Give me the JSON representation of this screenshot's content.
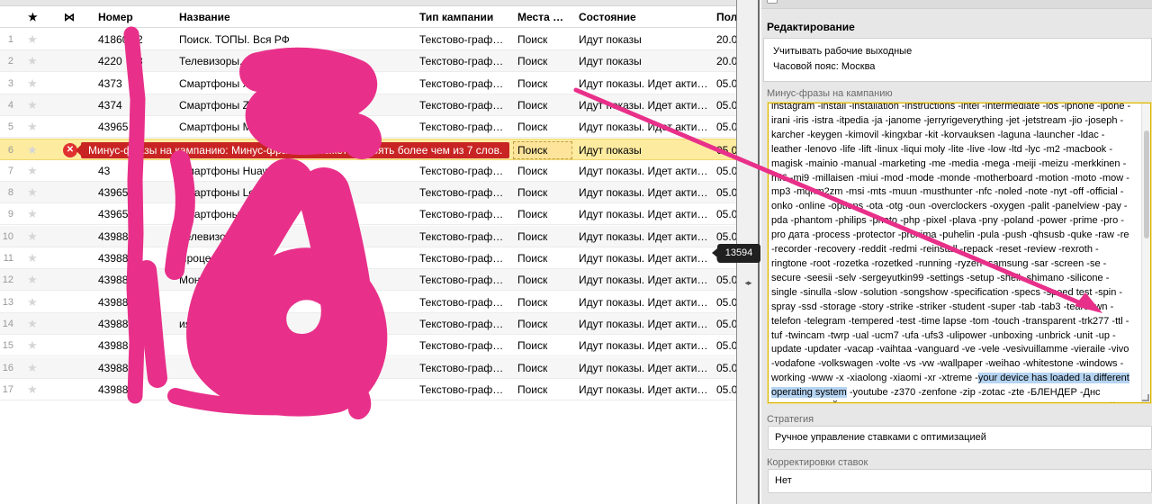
{
  "grid": {
    "headers": {
      "star": "★",
      "icon": "⋈",
      "number": "Номер",
      "name": "Название",
      "type": "Тип кампании",
      "places": "Места …",
      "state": "Состояние",
      "date": "Пол"
    },
    "rows": [
      {
        "n": "1",
        "star": "★",
        "number": "41860",
        "number_tail": "2",
        "name": "Поиск. ТОПЫ. Вся РФ",
        "type": "Текстово-граф…",
        "place": "Поиск",
        "state": "Идут показы",
        "date": "20.0"
      },
      {
        "n": "2",
        "star": "★",
        "number": "4220",
        "number_tail": "3",
        "name": "Телевизоры. П",
        "type": "Текстово-граф…",
        "place": "Поиск",
        "state": "Идут показы",
        "date": "20.0"
      },
      {
        "n": "3",
        "star": "★",
        "number": "4373",
        "number_tail": "0",
        "name": "Смартфоны Xi",
        "type": "Текстово-граф…",
        "place": "Поиск",
        "state": "Идут показы. Идет акти…",
        "date": "05.0"
      },
      {
        "n": "4",
        "star": "★",
        "number": "4374",
        "number_tail": "3",
        "name": "Смартфоны ZTE Г",
        "type": "Текстово-граф…",
        "place": "Поиск",
        "state": "Идут показы. Идет акти…",
        "date": "05.0"
      },
      {
        "n": "5",
        "star": "★",
        "number": "43965",
        "number_tail": "",
        "name": "Смартфоны MEIZ",
        "type": "Текстово-граф…",
        "place": "Поиск",
        "state": "Идут показы. Идет акти…",
        "date": "05.0"
      },
      {
        "n": "6",
        "star": "★",
        "number": "",
        "number_tail": "",
        "name": "",
        "type": "",
        "place": "Поиск",
        "state": "Идут показы",
        "date": "05.0",
        "error": "Минус-фразы на кампанию: Минус-фраза не может состоять более чем из 7 слов."
      },
      {
        "n": "7",
        "star": "★",
        "number": "43",
        "number_tail": "9",
        "name": "Смартфоны Huawei П",
        "type": "Текстово-граф…",
        "place": "Поиск",
        "state": "Идут показы. Идет акти…",
        "date": "05.0"
      },
      {
        "n": "8",
        "star": "★",
        "number": "43965",
        "number_tail": "",
        "name": "Смартфоны Len",
        "type": "Текстово-граф…",
        "place": "Поиск",
        "state": "Идут показы. Идет акти…",
        "date": "05.0"
      },
      {
        "n": "9",
        "star": "★",
        "number": "43965",
        "number_tail": "",
        "name": "Смартфоны VI",
        "type": "Текстово-граф…",
        "place": "Поиск",
        "state": "Идут показы. Идет акти…",
        "date": "05.0"
      },
      {
        "n": "10",
        "star": "★",
        "number": "43988",
        "number_tail": "",
        "name": "Телевизоры X",
        "type": "Текстово-граф…",
        "place": "Поиск",
        "state": "Идут показы. Идет акти…",
        "date": "05.0"
      },
      {
        "n": "11",
        "star": "★",
        "number": "43988",
        "number_tail": "",
        "name": "Проце",
        "type": "Текстово-граф…",
        "place": "Поиск",
        "state": "Идут показы. Идет акти…",
        "date": "05.0"
      },
      {
        "n": "12",
        "star": "★",
        "number": "43988",
        "number_tail": "",
        "name": "Мон",
        "type": "Текстово-граф…",
        "place": "Поиск",
        "state": "Идут показы. Идет акти…",
        "date": "05.0"
      },
      {
        "n": "13",
        "star": "★",
        "number": "43988",
        "number_tail": "",
        "name": "",
        "type": "Текстово-граф…",
        "place": "Поиск",
        "state": "Идут показы. Идет акти…",
        "date": "05.0"
      },
      {
        "n": "14",
        "star": "★",
        "number": "43988",
        "number_tail": "",
        "name": "ия Пои",
        "type": "Текстово-граф…",
        "place": "Поиск",
        "state": "Идут показы. Идет акти…",
        "date": "05.0"
      },
      {
        "n": "15",
        "star": "★",
        "number": "43988",
        "number_tail": "",
        "name": "",
        "type": "Текстово-граф…",
        "place": "Поиск",
        "state": "Идут показы. Идет акти…",
        "date": "05.0"
      },
      {
        "n": "16",
        "star": "★",
        "number": "43988",
        "number_tail": "",
        "name": "",
        "type": "Текстово-граф…",
        "place": "Поиск",
        "state": "Идут показы. Идет акти…",
        "date": "05.0"
      },
      {
        "n": "17",
        "star": "★",
        "number": "43988",
        "number_tail": "",
        "name": "",
        "type": "Текстово-граф…",
        "place": "Поиск",
        "state": "Идут показы. Идет акти…",
        "date": "05.0"
      }
    ],
    "error_icon": "error-x-icon",
    "error_glyph": "✕"
  },
  "divider": {
    "handle": "◂▸"
  },
  "badge": {
    "count": "13594"
  },
  "panel": {
    "title": "Редактирование",
    "settings": {
      "workdays": "Учитывать рабочие выходные",
      "timezone": "Часовой пояс: Москва"
    },
    "minus_label": "Минус-фразы на кампанию",
    "minus_before": "instagram -install -installation -instructions -intel -intermediate -ios -iphone -ipone -irani -iris -istra -itpedia -ja -janome -jerryrigeverything -jet -jetstream -jio -joseph -karcher -keygen -kimovil -kingxbar -kit -korvauksen -laguna -launcher -ldac -leather -lenovo -life -lift -linux -liqui moly -lite -live -low -ltd -lyc -m2 -macbook -magisk -mainio -manual -marketing -me -media -mega -meiji -meizu -merkkinen -mi6 -mi9 -millaisen -miui -mod -mode -monde -motherboard -motion -moto -mow -mp3 -mqhm2zm -msi -mts -muun -musthunter -nfc -noled -note -nyt -off -official -onko -online -options -ota -otg -oun -overclockers -oxygen -palit -panelview -pay -pda -phantom -philips -photo -php -pixel -plava -pny -poland -power -prime -pro -pro дата -process -protector -proxima -puhelin -pula -push -qhsusb -quke -raw -re -recorder -recovery -reddit -redmi -reinstall -repack -reset -review -rexroth -ringtone -root -rozetka -rozetked -running -ryzen -samsung -sar -screen -se -secure -seesii -selv -sergeyutkin99 -settings -setup -shell -shimano -silicone -single -sinulla -slow -solution -songshow -specification -specs -speed test -spin -spray -ssd -storage -story -strike -striker -student -super -tab -tab3 -teardown -telefon -telegram -tempered -test -time lapse -tom -touch -transparent -trk277 -ttl -tuf -twincam -twrp -ual -ucm7 -ufa -ufs3 -ulipower -unboxing -unbrick -unit -up -update -updater -vacap -vaihtaa -vanguard -ve -vele -vesivuillamme -vieraile -vivo -vodafone -volkswagen -volte -vs -vw -wallpaper -weihao -whitestone -windows -working -www -x -xiaolong -xiaomi -xr -xtreme -",
    "minus_highlight": "your device has loaded !a different operating system",
    "minus_after": " -youtube -z370 -zenfone -zip -zotac -zte -БЛЕНДЕР -Днс -ПОГРУЖНОЙ -Ситилинк -Технопоинт -Фотосклад -ав -авито -автонастройки -автономной -автономность -авторадио -аирподс -айфон -аккаунта -активация -актуален -актуальность -алису -алиэкспресс -аналог -анимацию -антуту -апертура -аудиокодеки -бампер -батарея -без звука -беззвучный -бесплатно -биг -бичмарк -блок -блютуз -боковые -бу -будильник -бывают -версии -весит -вживую -вибрацию -вибро -вибромотор -виброоткдик -видео -видеокамера -видеокарта -видеообзор -видеоприем",
    "strategy_label": "Стратегия",
    "strategy_value": "Ручное управление ставками с оптимизацией",
    "bid_label": "Корректировки ставок",
    "bid_value": "Нет"
  },
  "colors": {
    "scribble": "#e8308a",
    "arrow": "#e8308a",
    "error_row": "#fdeba0",
    "error_tip": "#c92424",
    "highlight": "#b5d4f2"
  }
}
